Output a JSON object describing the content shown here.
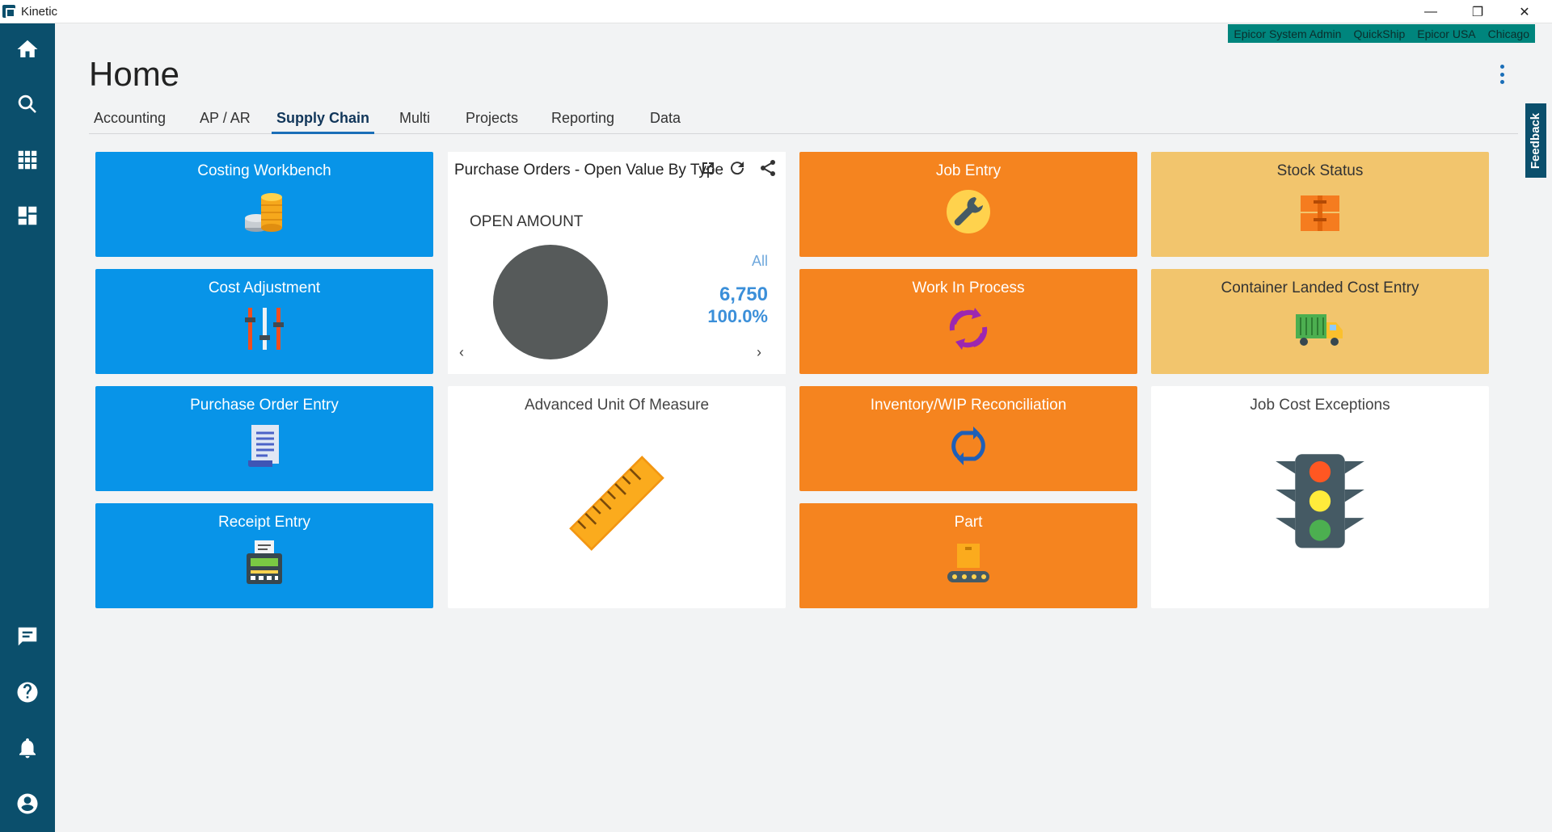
{
  "window": {
    "app_name": "Kinetic",
    "minimize": "—",
    "restore": "❐",
    "close": "✕"
  },
  "userbar": [
    "Epicor System Admin",
    "QuickShip",
    "Epicor USA",
    "Chicago"
  ],
  "page": {
    "title": "Home"
  },
  "tabs": [
    "Accounting",
    "AP / AR",
    "Supply Chain",
    "Multi",
    "Projects",
    "Reporting",
    "Data"
  ],
  "active_tab": "Supply Chain",
  "feedback": "Feedback",
  "tiles": {
    "costing_workbench": "Costing Workbench",
    "cost_adjustment": "Cost Adjustment",
    "purchase_order_entry": "Purchase Order Entry",
    "receipt_entry": "Receipt Entry",
    "advanced_uom": "Advanced Unit Of Measure",
    "job_entry": "Job Entry",
    "work_in_process": "Work In Process",
    "inventory_wip": "Inventory/WIP Reconciliation",
    "part": "Part",
    "stock_status": "Stock Status",
    "container_landed_cost": "Container Landed Cost Entry",
    "job_cost_exceptions": "Job Cost Exceptions"
  },
  "widget": {
    "title": "Purchase Orders - Open Value By Type",
    "subtitle": "OPEN AMOUNT",
    "filter": "All",
    "value": "6,750",
    "percent": "100.0%",
    "prev": "‹",
    "next": "›"
  },
  "chart_data": {
    "type": "pie",
    "title": "OPEN AMOUNT",
    "slices": [
      {
        "label": "All",
        "value": 6750,
        "percent": 100.0,
        "color": "#565a5a"
      }
    ]
  },
  "colors": {
    "sidebar": "#0b4f6c",
    "blue_tile": "#0894e8",
    "orange_tile": "#f5841f",
    "yellow_tile": "#f2c56d",
    "userbar": "#00857d",
    "accent": "#1a6eb8"
  }
}
